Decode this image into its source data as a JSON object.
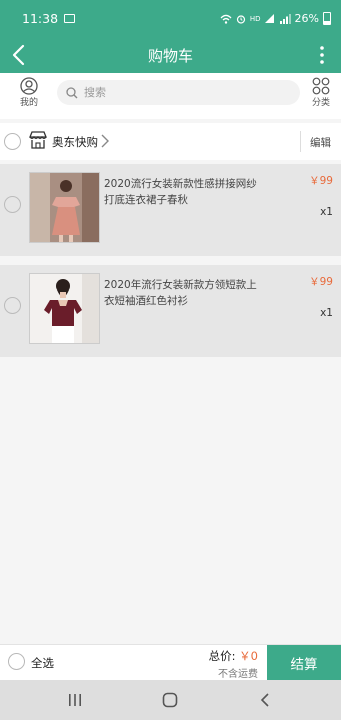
{
  "status_bar": {
    "time": "11:38",
    "network": "HD",
    "battery": "26%"
  },
  "app_bar": {
    "title": "购物车"
  },
  "search": {
    "mine_label": "我的",
    "placeholder": "搜索",
    "category_label": "分类"
  },
  "shop": {
    "name": "奥东快购",
    "edit_label": "编辑"
  },
  "items": [
    {
      "name": "2020流行女装新款性感拼接网纱打底连衣裙子春秋",
      "price": "￥99",
      "qty": "x1"
    },
    {
      "name": "2020年流行女装新款方领短款上衣短袖酒红色衬衫",
      "price": "￥99",
      "qty": "x1"
    }
  ],
  "footer": {
    "select_all": "全选",
    "total_label": "总价:",
    "total_amount": "￥0",
    "shipping_note": "不含运费",
    "checkout": "结算"
  },
  "colors": {
    "brand": "#3daa8a",
    "price": "#e86b3c"
  }
}
